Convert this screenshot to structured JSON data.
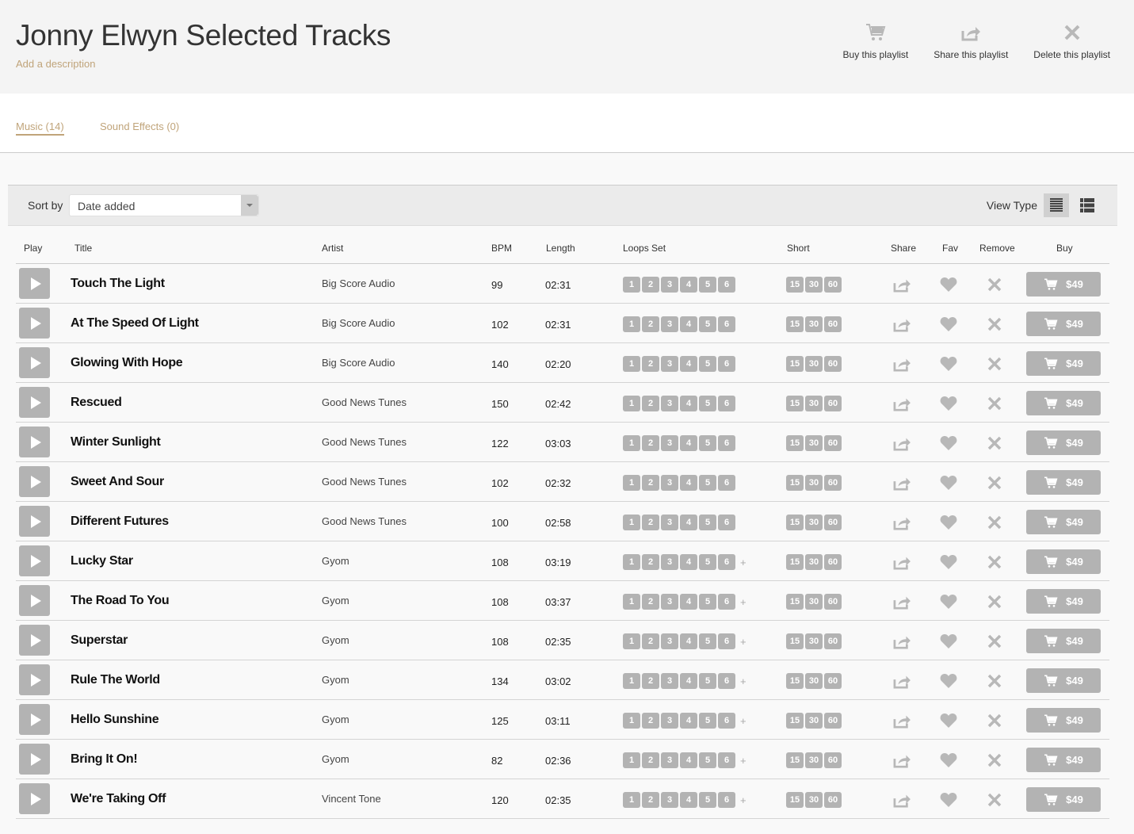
{
  "header": {
    "title": "Jonny Elwyn Selected Tracks",
    "add_description": "Add a description",
    "actions": [
      {
        "label": "Buy this playlist",
        "icon": "cart-icon"
      },
      {
        "label": "Share this playlist",
        "icon": "share-icon"
      },
      {
        "label": "Delete this playlist",
        "icon": "close-icon"
      }
    ]
  },
  "tabs": [
    {
      "label": "Music (14)",
      "active": true
    },
    {
      "label": "Sound Effects (0)",
      "active": false
    }
  ],
  "toolbar": {
    "sort_label": "Sort by",
    "sort_value": "Date added",
    "view_type_label": "View Type"
  },
  "columns": {
    "play": "Play",
    "title": "Title",
    "artist": "Artist",
    "bpm": "BPM",
    "length": "Length",
    "loops": "Loops Set",
    "short": "Short",
    "share": "Share",
    "fav": "Fav",
    "remove": "Remove",
    "buy": "Buy"
  },
  "colors": {
    "accent": "#c0a47a",
    "chip": "#b3b3b3"
  },
  "loop_labels": [
    "1",
    "2",
    "3",
    "4",
    "5",
    "6"
  ],
  "short_labels": [
    "15",
    "30",
    "60"
  ],
  "tracks": [
    {
      "title": "Touch The Light",
      "artist": "Big Score Audio",
      "bpm": "99",
      "length": "02:31",
      "more_loops": false,
      "price": "$49"
    },
    {
      "title": "At The Speed Of Light",
      "artist": "Big Score Audio",
      "bpm": "102",
      "length": "02:31",
      "more_loops": false,
      "price": "$49"
    },
    {
      "title": "Glowing With Hope",
      "artist": "Big Score Audio",
      "bpm": "140",
      "length": "02:20",
      "more_loops": false,
      "price": "$49"
    },
    {
      "title": "Rescued",
      "artist": "Good News Tunes",
      "bpm": "150",
      "length": "02:42",
      "more_loops": false,
      "price": "$49"
    },
    {
      "title": "Winter Sunlight",
      "artist": "Good News Tunes",
      "bpm": "122",
      "length": "03:03",
      "more_loops": false,
      "price": "$49"
    },
    {
      "title": "Sweet And Sour",
      "artist": "Good News Tunes",
      "bpm": "102",
      "length": "02:32",
      "more_loops": false,
      "price": "$49"
    },
    {
      "title": "Different Futures",
      "artist": "Good News Tunes",
      "bpm": "100",
      "length": "02:58",
      "more_loops": false,
      "price": "$49"
    },
    {
      "title": "Lucky Star",
      "artist": "Gyom",
      "bpm": "108",
      "length": "03:19",
      "more_loops": true,
      "price": "$49"
    },
    {
      "title": "The Road To You",
      "artist": "Gyom",
      "bpm": "108",
      "length": "03:37",
      "more_loops": true,
      "price": "$49"
    },
    {
      "title": "Superstar",
      "artist": "Gyom",
      "bpm": "108",
      "length": "02:35",
      "more_loops": true,
      "price": "$49"
    },
    {
      "title": "Rule The World",
      "artist": "Gyom",
      "bpm": "134",
      "length": "03:02",
      "more_loops": true,
      "price": "$49"
    },
    {
      "title": "Hello Sunshine",
      "artist": "Gyom",
      "bpm": "125",
      "length": "03:11",
      "more_loops": true,
      "price": "$49"
    },
    {
      "title": "Bring It On!",
      "artist": "Gyom",
      "bpm": "82",
      "length": "02:36",
      "more_loops": true,
      "price": "$49"
    },
    {
      "title": "We're Taking Off",
      "artist": "Vincent Tone",
      "bpm": "120",
      "length": "02:35",
      "more_loops": true,
      "price": "$49"
    }
  ]
}
